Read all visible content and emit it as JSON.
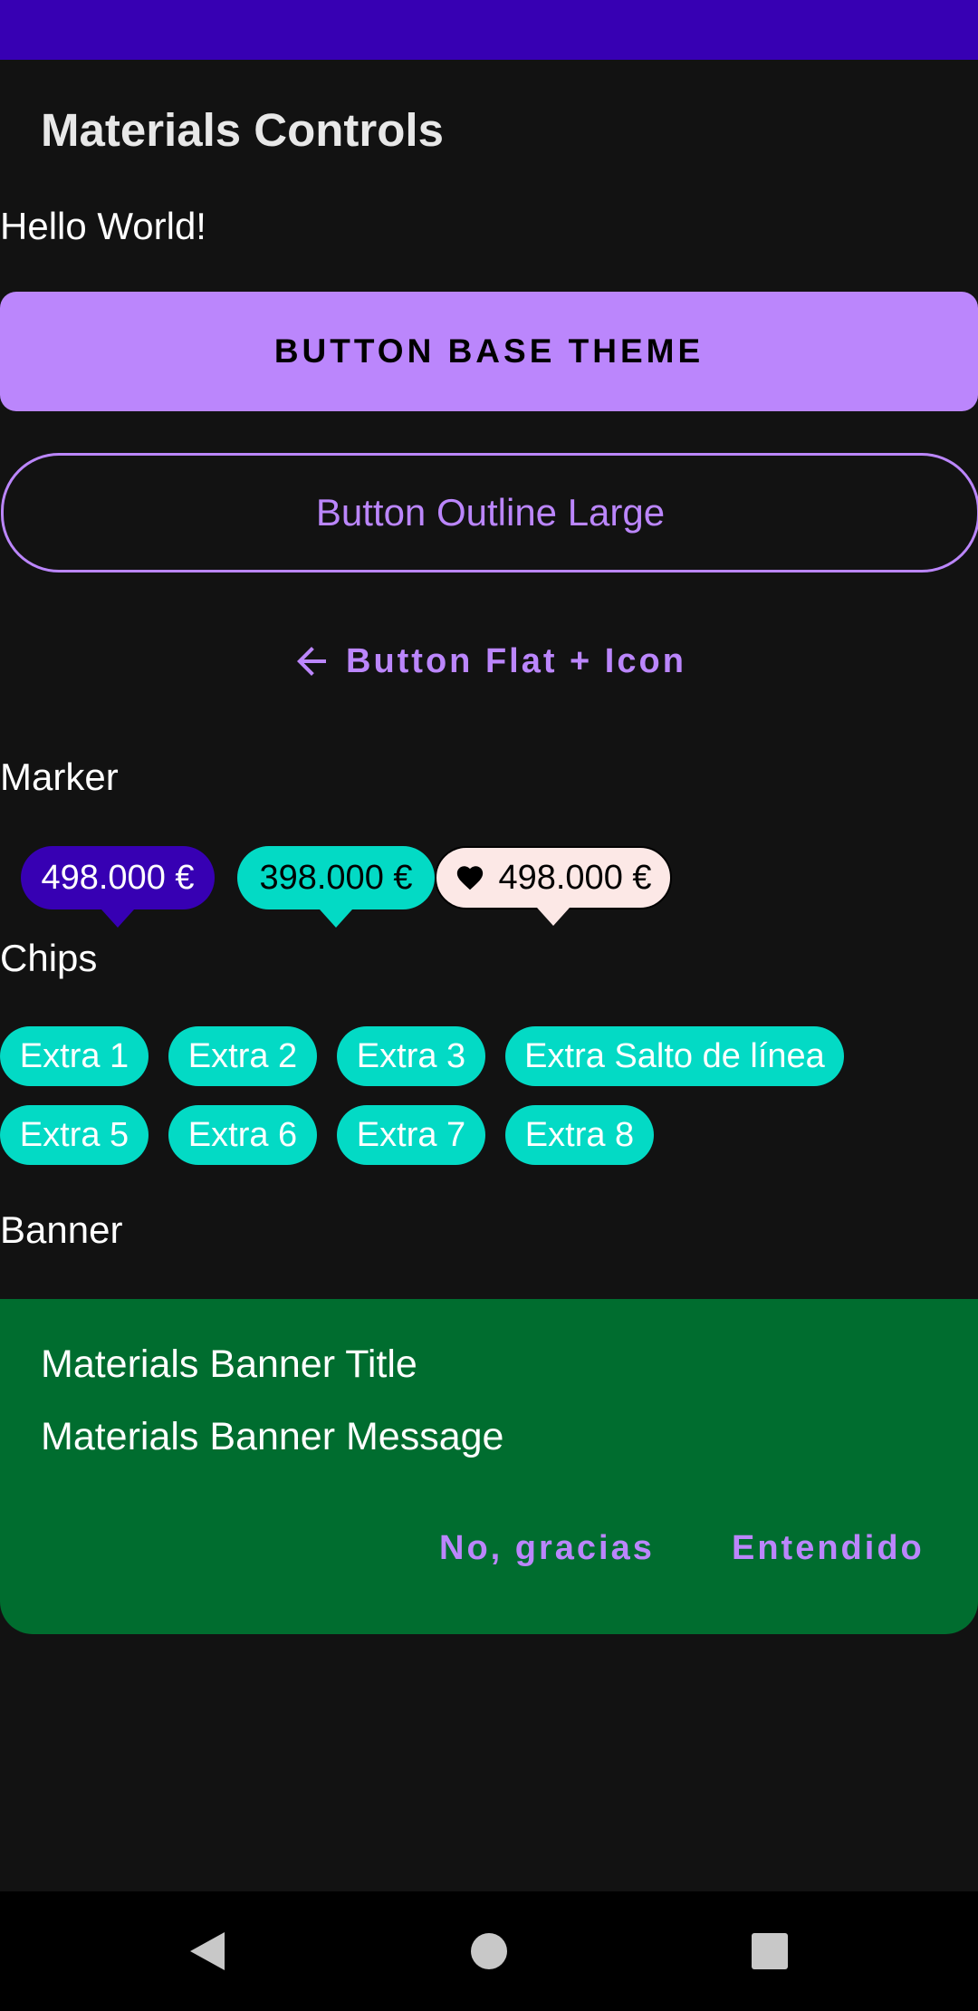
{
  "app": {
    "title": "Materials Controls"
  },
  "content": {
    "hello_text": "Hello World!",
    "button_base_label": "BUTTON BASE THEME",
    "button_outline_label": "Button Outline Large",
    "button_flat_label": "Button Flat + Icon",
    "button_flat_icon": "arrow-back-icon"
  },
  "markers": {
    "section_label": "Marker",
    "items": [
      {
        "label": "498.000 €",
        "bg": "#3700B3",
        "color": "#ffffff"
      },
      {
        "label": "398.000 €",
        "bg": "#03DAC5",
        "color": "#000000"
      },
      {
        "label": "498.000 €",
        "bg": "#FCE8E6",
        "color": "#000000",
        "icon": "heart-icon"
      }
    ]
  },
  "chips": {
    "section_label": "Chips",
    "items": [
      "Extra 1",
      "Extra 2",
      "Extra 3",
      "Extra Salto de línea",
      "Extra 5",
      "Extra 6",
      "Extra 7",
      "Extra 8"
    ]
  },
  "banner": {
    "section_label": "Banner",
    "title": "Materials Banner Title",
    "message": "Materials Banner Message",
    "dismiss_label": "No, gracias",
    "confirm_label": "Entendido"
  },
  "navigation": {
    "back_icon": "back-triangle-icon",
    "home_icon": "home-circle-icon",
    "recents_icon": "recents-square-icon"
  },
  "colors": {
    "status_bar": "#3700B3",
    "background": "#121212",
    "primary": "#BB86FC",
    "secondary": "#03DAC5",
    "banner": "#006D2F"
  }
}
